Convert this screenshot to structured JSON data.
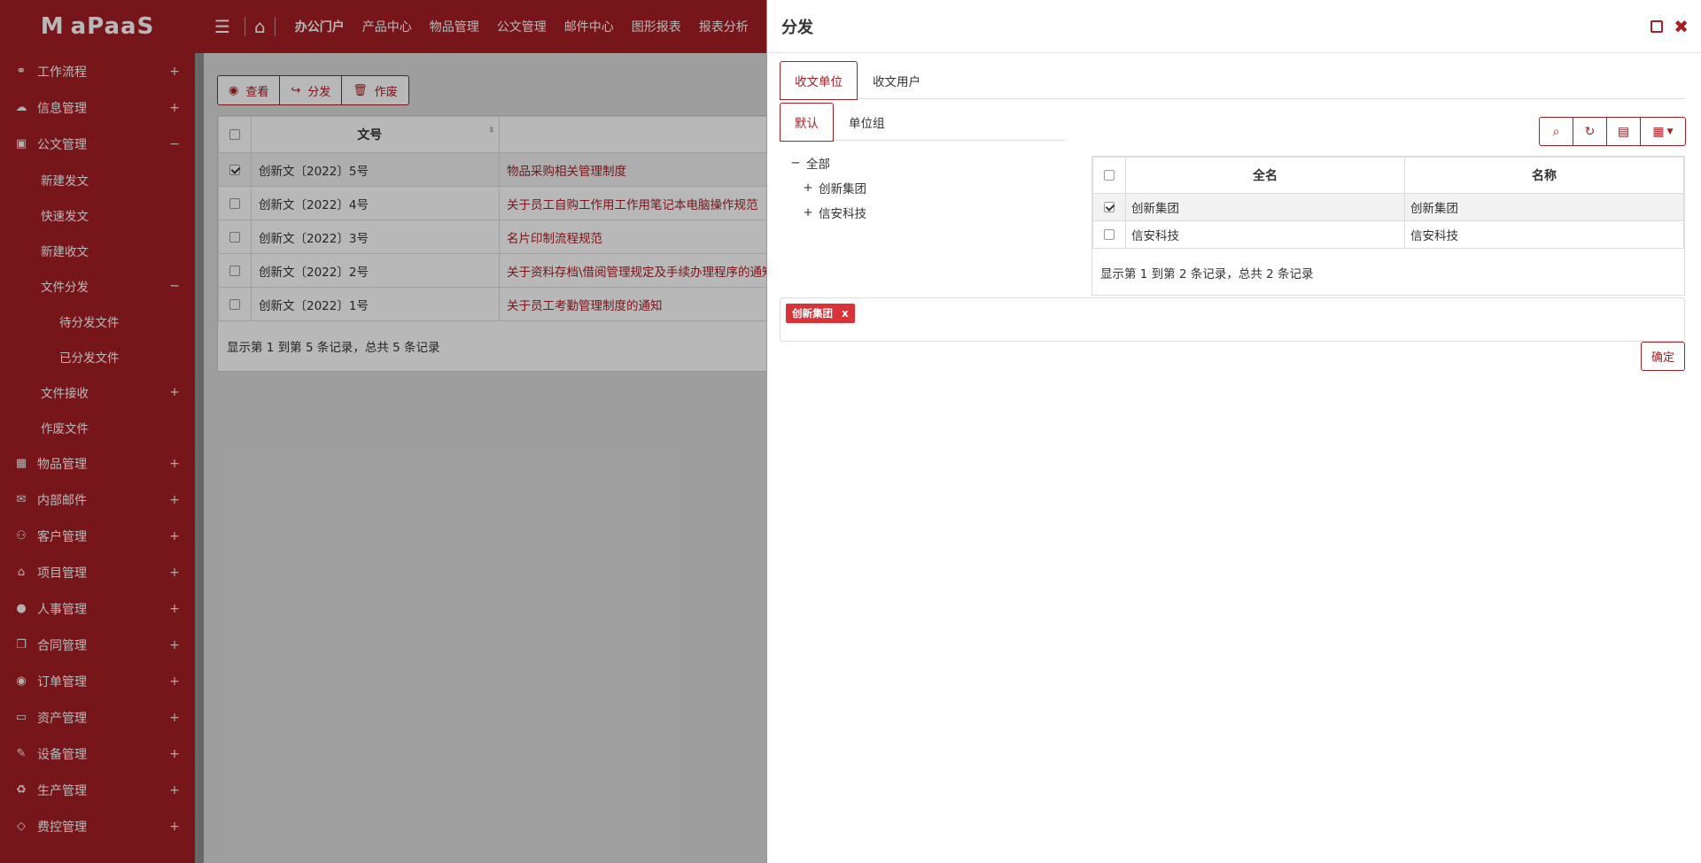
{
  "brand": {
    "mark": "M",
    "name": "aPaaS"
  },
  "topnav": [
    "办公门户",
    "产品中心",
    "物品管理",
    "公文管理",
    "邮件中心",
    "图形报表",
    "报表分析"
  ],
  "sidebar": {
    "items": [
      {
        "icon": "sitemap-icon",
        "glyph": "⚭",
        "label": "工作流程",
        "sign": "+"
      },
      {
        "icon": "comments-icon",
        "glyph": "☁",
        "label": "信息管理",
        "sign": "+"
      },
      {
        "icon": "briefcase-icon",
        "glyph": "▣",
        "label": "公文管理",
        "sign": "−"
      },
      {
        "icon": "calendar-icon",
        "glyph": "▦",
        "label": "物品管理",
        "sign": "+"
      },
      {
        "icon": "envelope-icon",
        "glyph": "✉",
        "label": "内部邮件",
        "sign": "+"
      },
      {
        "icon": "handshake-icon",
        "glyph": "⚇",
        "label": "客户管理",
        "sign": "+"
      },
      {
        "icon": "bank-icon",
        "glyph": "⌂",
        "label": "项目管理",
        "sign": "+"
      },
      {
        "icon": "user-circle-icon",
        "glyph": "●",
        "label": "人事管理",
        "sign": "+"
      },
      {
        "icon": "copy-icon",
        "glyph": "❐",
        "label": "合同管理",
        "sign": "+"
      },
      {
        "icon": "order-icon",
        "glyph": "◉",
        "label": "订单管理",
        "sign": "+"
      },
      {
        "icon": "desktop-icon",
        "glyph": "▭",
        "label": "资产管理",
        "sign": "+"
      },
      {
        "icon": "wrench-icon",
        "glyph": "✎",
        "label": "设备管理",
        "sign": "+"
      },
      {
        "icon": "recycle-icon",
        "glyph": "♻",
        "label": "生产管理",
        "sign": "+"
      },
      {
        "icon": "code-icon",
        "glyph": "◇",
        "label": "费控管理",
        "sign": "+"
      }
    ],
    "doc_sub": [
      {
        "label": "新建发文",
        "sign": ""
      },
      {
        "label": "快速发文",
        "sign": ""
      },
      {
        "label": "新建收文",
        "sign": ""
      },
      {
        "label": "文件分发",
        "sign": "−"
      }
    ],
    "dist_sub": [
      "待分发文件",
      "已分发文件"
    ],
    "doc_sub2": [
      {
        "label": "文件接收",
        "sign": "+"
      },
      {
        "label": "作废文件",
        "sign": ""
      }
    ]
  },
  "toolbar": {
    "view": "查看",
    "distribute": "分发",
    "void": "作废"
  },
  "doc_grid": {
    "col_number": "文号",
    "rows": [
      {
        "checked": true,
        "number": "创新文〔2022〕5号",
        "title": "物品采购相关管理制度"
      },
      {
        "checked": false,
        "number": "创新文〔2022〕4号",
        "title": "关于员工自购工作用工作用笔记本电脑操作规范"
      },
      {
        "checked": false,
        "number": "创新文〔2022〕3号",
        "title": "名片印制流程规范"
      },
      {
        "checked": false,
        "number": "创新文〔2022〕2号",
        "title": "关于资料存档\\借阅管理规定及手续办理程序的通知"
      },
      {
        "checked": false,
        "number": "创新文〔2022〕1号",
        "title": "关于员工考勤管理制度的通知"
      }
    ],
    "footer": "显示第 1 到第 5 条记录，总共 5 条记录"
  },
  "panel": {
    "title": "分发",
    "tabs": [
      "收文单位",
      "收文用户"
    ],
    "subtabs": [
      "默认",
      "单位组"
    ],
    "tree": {
      "root": "全部",
      "children": [
        "创新集团",
        "信安科技"
      ]
    },
    "unit_grid": {
      "col_fullname": "全名",
      "col_name": "名称",
      "rows": [
        {
          "checked": true,
          "fullname": "创新集团",
          "name": "创新集团"
        },
        {
          "checked": false,
          "fullname": "信安科技",
          "name": "信安科技"
        }
      ],
      "footer": "显示第 1 到第 2 条记录，总共 2 条记录"
    },
    "selected_tags": [
      {
        "label": "创新集团",
        "remove": "x"
      }
    ],
    "confirm": "确定"
  },
  "colors": {
    "brand": "#a51f24",
    "tag": "#d9333a"
  }
}
